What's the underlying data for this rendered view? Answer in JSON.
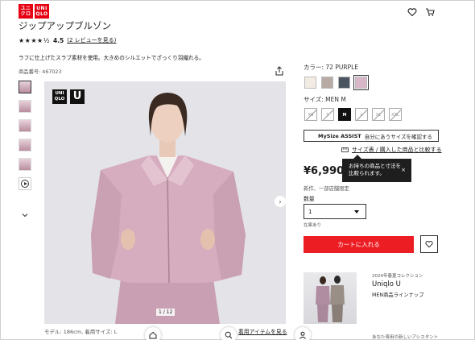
{
  "header": {
    "logo_top": "ユニ クロ",
    "logo_top_l": "ユニ",
    "logo_top_b": "クロ",
    "logo_en_l": "UNI",
    "logo_en_b": "QLO",
    "icons": [
      "heart-icon",
      "cart-icon"
    ]
  },
  "product": {
    "title": "ジップアップブルゾン",
    "stars": "★★★★½",
    "rating": "4.5",
    "review_link": "(2 レビューを見る)",
    "description": "ラフに仕上げたスラブ素材を使用。大きめのシルエットでざっくり羽織れる。",
    "product_no": "商品番号: 467023"
  },
  "gallery": {
    "badge_top": "UNI",
    "badge_bottom": "QLO",
    "badge_u": "U",
    "counter": "1 / 12",
    "model_info": "モデル: 186cm, 着用サイズ: L",
    "coordinate_link": "着用アイテムを見る"
  },
  "options": {
    "color_label": "カラー: 72 PURPLE",
    "colors": [
      "#f3ece4",
      "#b8aaa4",
      "#4b5560",
      "#d9b6c8"
    ],
    "size_label": "サイズ: MEN M",
    "sizes": [
      "XS",
      "S",
      "M",
      "L",
      "XL",
      "XXL"
    ],
    "mysize_brand": "MySize ASSIST",
    "mysize_text": "自分にあうサイズを確認する",
    "size_link": "サイズ表 / 購入した商品と比較する",
    "tooltip_line1": "お持ちの商品と寸法を",
    "tooltip_line2": "比較られます。",
    "tooltip_close": "×"
  },
  "purchase": {
    "price": "¥6,990",
    "note": "新作、一部店舗限定",
    "qty_label": "数量",
    "qty_value": "1",
    "stock": "在庫あり",
    "cart_button": "カートに入れる"
  },
  "collection": {
    "small": "2024年春夏コレクション",
    "title": "Uniqlo U",
    "subtitle": "MEN商品ラインナップ",
    "assist": "あなた専用の新しいアシスタント"
  }
}
